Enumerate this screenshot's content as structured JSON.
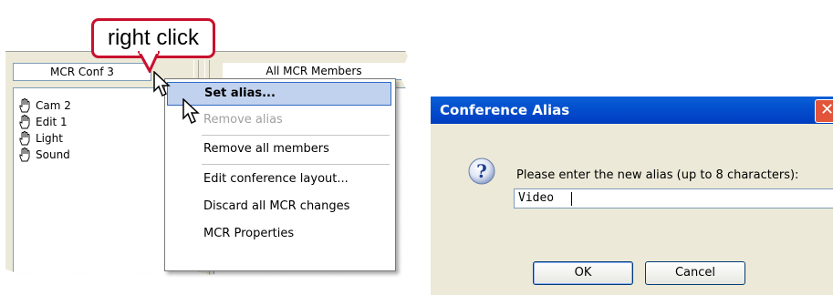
{
  "callout": {
    "text": "right click"
  },
  "left_panel": {
    "conference_header": "MCR Conf 3",
    "members_header": "All MCR Members",
    "items": [
      {
        "label": "Cam 2"
      },
      {
        "label": "Edit 1"
      },
      {
        "label": "Light"
      },
      {
        "label": "Sound"
      }
    ]
  },
  "context_menu": {
    "items": [
      {
        "label": "Set alias...",
        "state": "selected"
      },
      {
        "label": "Remove alias",
        "state": "disabled"
      },
      {
        "label": "Remove all members",
        "state": "normal"
      },
      {
        "label": "Edit conference layout...",
        "state": "normal"
      },
      {
        "label": "Discard all MCR changes",
        "state": "normal"
      },
      {
        "label": "MCR Properties",
        "state": "normal"
      }
    ]
  },
  "dialog": {
    "title": "Conference Alias",
    "prompt": "Please enter the new alias (up to 8 characters):",
    "input_value": "Video",
    "ok_label": "OK",
    "cancel_label": "Cancel"
  },
  "colors": {
    "callout_border": "#c8102e",
    "menu_highlight": "#c1d2ee",
    "title_bar": "#0454d0",
    "close_button": "#e2553b"
  },
  "icons": [
    "hand-icon",
    "question-icon",
    "close-icon",
    "arrow-cursor-icon"
  ]
}
